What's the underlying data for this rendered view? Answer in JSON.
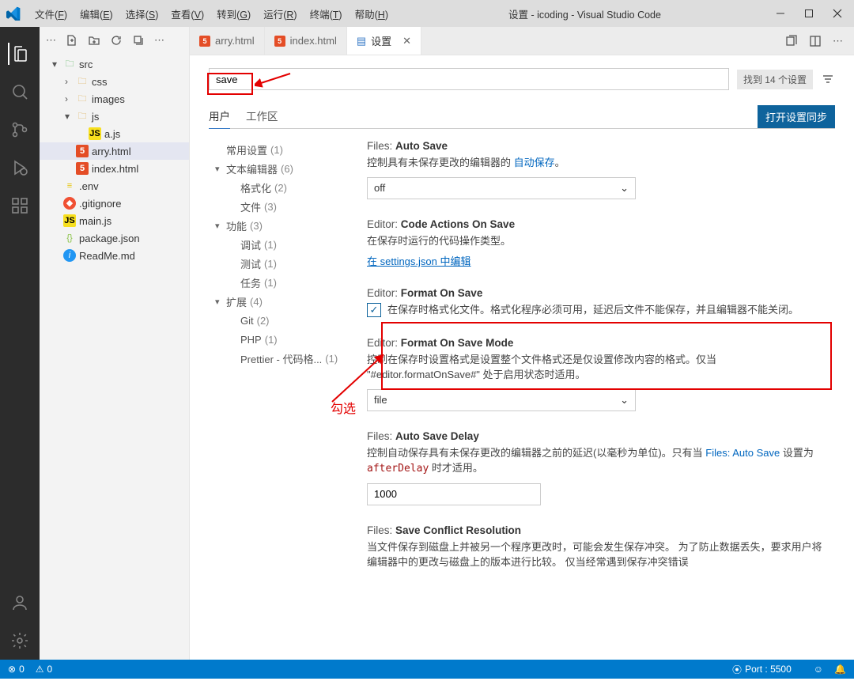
{
  "titlebar": {
    "menu": [
      {
        "label": "文件",
        "mnemonic": "F"
      },
      {
        "label": "编辑",
        "mnemonic": "E"
      },
      {
        "label": "选择",
        "mnemonic": "S"
      },
      {
        "label": "查看",
        "mnemonic": "V"
      },
      {
        "label": "转到",
        "mnemonic": "G"
      },
      {
        "label": "运行",
        "mnemonic": "R"
      },
      {
        "label": "终端",
        "mnemonic": "T"
      },
      {
        "label": "帮助",
        "mnemonic": "H"
      }
    ],
    "title": "设置 - icoding - Visual Studio Code"
  },
  "tree": {
    "items": [
      {
        "depth": 1,
        "twisty": "▾",
        "icon": "folder-green",
        "label": "src"
      },
      {
        "depth": 2,
        "twisty": "›",
        "icon": "folder",
        "label": "css"
      },
      {
        "depth": 2,
        "twisty": "›",
        "icon": "folder",
        "label": "images"
      },
      {
        "depth": 2,
        "twisty": "▾",
        "icon": "folder",
        "label": "js"
      },
      {
        "depth": 3,
        "twisty": "",
        "icon": "js",
        "label": "a.js"
      },
      {
        "depth": 2,
        "twisty": "",
        "icon": "html5",
        "label": "arry.html",
        "selected": true
      },
      {
        "depth": 2,
        "twisty": "",
        "icon": "html5",
        "label": "index.html"
      },
      {
        "depth": 1,
        "twisty": "",
        "icon": "env",
        "label": ".env"
      },
      {
        "depth": 1,
        "twisty": "",
        "icon": "git",
        "label": ".gitignore"
      },
      {
        "depth": 1,
        "twisty": "",
        "icon": "js",
        "label": "main.js"
      },
      {
        "depth": 1,
        "twisty": "",
        "icon": "json",
        "label": "package.json"
      },
      {
        "depth": 1,
        "twisty": "",
        "icon": "info",
        "label": "ReadMe.md"
      }
    ]
  },
  "tabs": [
    {
      "icon": "html5",
      "label": "arry.html",
      "active": false
    },
    {
      "icon": "html5",
      "label": "index.html",
      "active": false
    },
    {
      "icon": "settings",
      "label": "设置",
      "active": true,
      "close": true
    }
  ],
  "search": {
    "value": "save",
    "results": "找到 14 个设置"
  },
  "scopes": {
    "user": "用户",
    "workspace": "工作区",
    "sync": "打开设置同步"
  },
  "toc": [
    {
      "d": 1,
      "tw": "",
      "label": "常用设置",
      "cnt": "(1)"
    },
    {
      "d": 1,
      "tw": "▾",
      "label": "文本编辑器",
      "cnt": "(6)"
    },
    {
      "d": 2,
      "tw": "",
      "label": "格式化",
      "cnt": "(2)"
    },
    {
      "d": 2,
      "tw": "",
      "label": "文件",
      "cnt": "(3)"
    },
    {
      "d": 1,
      "tw": "▾",
      "label": "功能",
      "cnt": "(3)"
    },
    {
      "d": 2,
      "tw": "",
      "label": "调试",
      "cnt": "(1)"
    },
    {
      "d": 2,
      "tw": "",
      "label": "测试",
      "cnt": "(1)"
    },
    {
      "d": 2,
      "tw": "",
      "label": "任务",
      "cnt": "(1)"
    },
    {
      "d": 1,
      "tw": "▾",
      "label": "扩展",
      "cnt": "(4)"
    },
    {
      "d": 2,
      "tw": "",
      "label": "Git",
      "cnt": "(2)"
    },
    {
      "d": 2,
      "tw": "",
      "label": "PHP",
      "cnt": "(1)"
    },
    {
      "d": 2,
      "tw": "",
      "label": "Prettier - 代码格...",
      "cnt": "(1)"
    }
  ],
  "settings": {
    "autoSave": {
      "cat": "Files:",
      "name": "Auto Save",
      "desc1": "控制具有未保存更改的编辑器的 ",
      "link": "自动保存",
      "desc2": "。",
      "value": "off"
    },
    "codeActions": {
      "cat": "Editor:",
      "name": "Code Actions On Save",
      "desc": "在保存时运行的代码操作类型。",
      "editIn": "在 settings.json 中编辑"
    },
    "formatOnSave": {
      "cat": "Editor:",
      "name": "Format On Save",
      "desc": "在保存时格式化文件。格式化程序必须可用，延迟后文件不能保存，并且编辑器不能关闭。"
    },
    "formatMode": {
      "cat": "Editor:",
      "name": "Format On Save Mode",
      "desc": "控制在保存时设置格式是设置整个文件格式还是仅设置修改内容的格式。仅当 \"#editor.formatOnSave#\" 处于启用状态时适用。",
      "value": "file"
    },
    "autoSaveDelay": {
      "cat": "Files:",
      "name": "Auto Save Delay",
      "desc1": "控制自动保存具有未保存更改的编辑器之前的延迟(以毫秒为单位)。只有当 ",
      "link": "Files: Auto Save",
      "desc2": " 设置为 ",
      "code": "afterDelay",
      "desc3": " 时才适用。",
      "value": "1000"
    },
    "conflict": {
      "cat": "Files:",
      "name": "Save Conflict Resolution",
      "desc": "当文件保存到磁盘上并被另一个程序更改时，可能会发生保存冲突。 为了防止数据丢失，要求用户将编辑器中的更改与磁盘上的版本进行比较。 仅当经常遇到保存冲突错误"
    }
  },
  "annot": {
    "check": "勾选"
  },
  "statusbar": {
    "errors": "0",
    "warnings": "0",
    "port": "Port : 5500"
  }
}
